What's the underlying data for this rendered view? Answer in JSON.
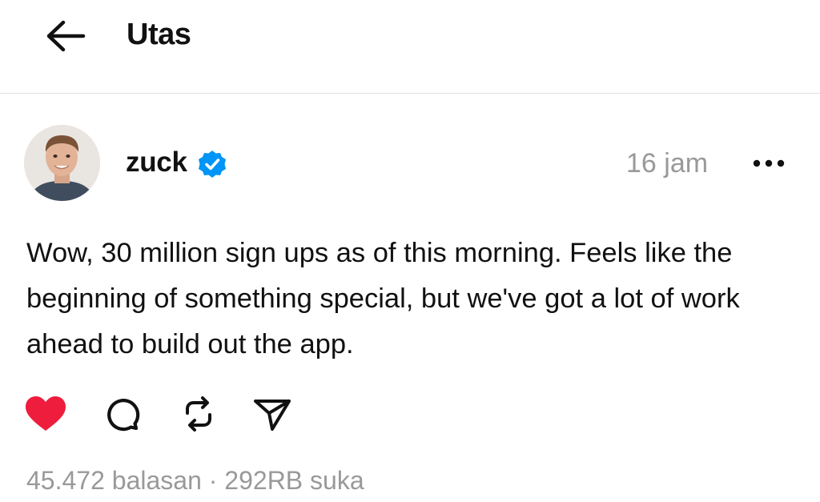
{
  "header": {
    "back_icon": "arrow-left-icon",
    "title": "Utas"
  },
  "post": {
    "avatar_icon": "avatar",
    "username": "zuck",
    "verified_icon": "verified-badge-icon",
    "verified_color": "#0095f6",
    "timestamp": "16 jam",
    "more_icon": "more-horizontal-icon",
    "text": "Wow, 30 million sign ups as of this morning. Feels like the beginning of something special, but we've got a lot of work ahead to build out the app."
  },
  "actions": [
    {
      "name": "like",
      "icon": "heart-filled-icon",
      "color": "#ee1d3d"
    },
    {
      "name": "reply",
      "icon": "comment-icon"
    },
    {
      "name": "repost",
      "icon": "repost-icon"
    },
    {
      "name": "share",
      "icon": "send-icon"
    }
  ],
  "stats": {
    "replies": "45.472 balasan",
    "separator": "·",
    "likes": "292RB suka"
  }
}
